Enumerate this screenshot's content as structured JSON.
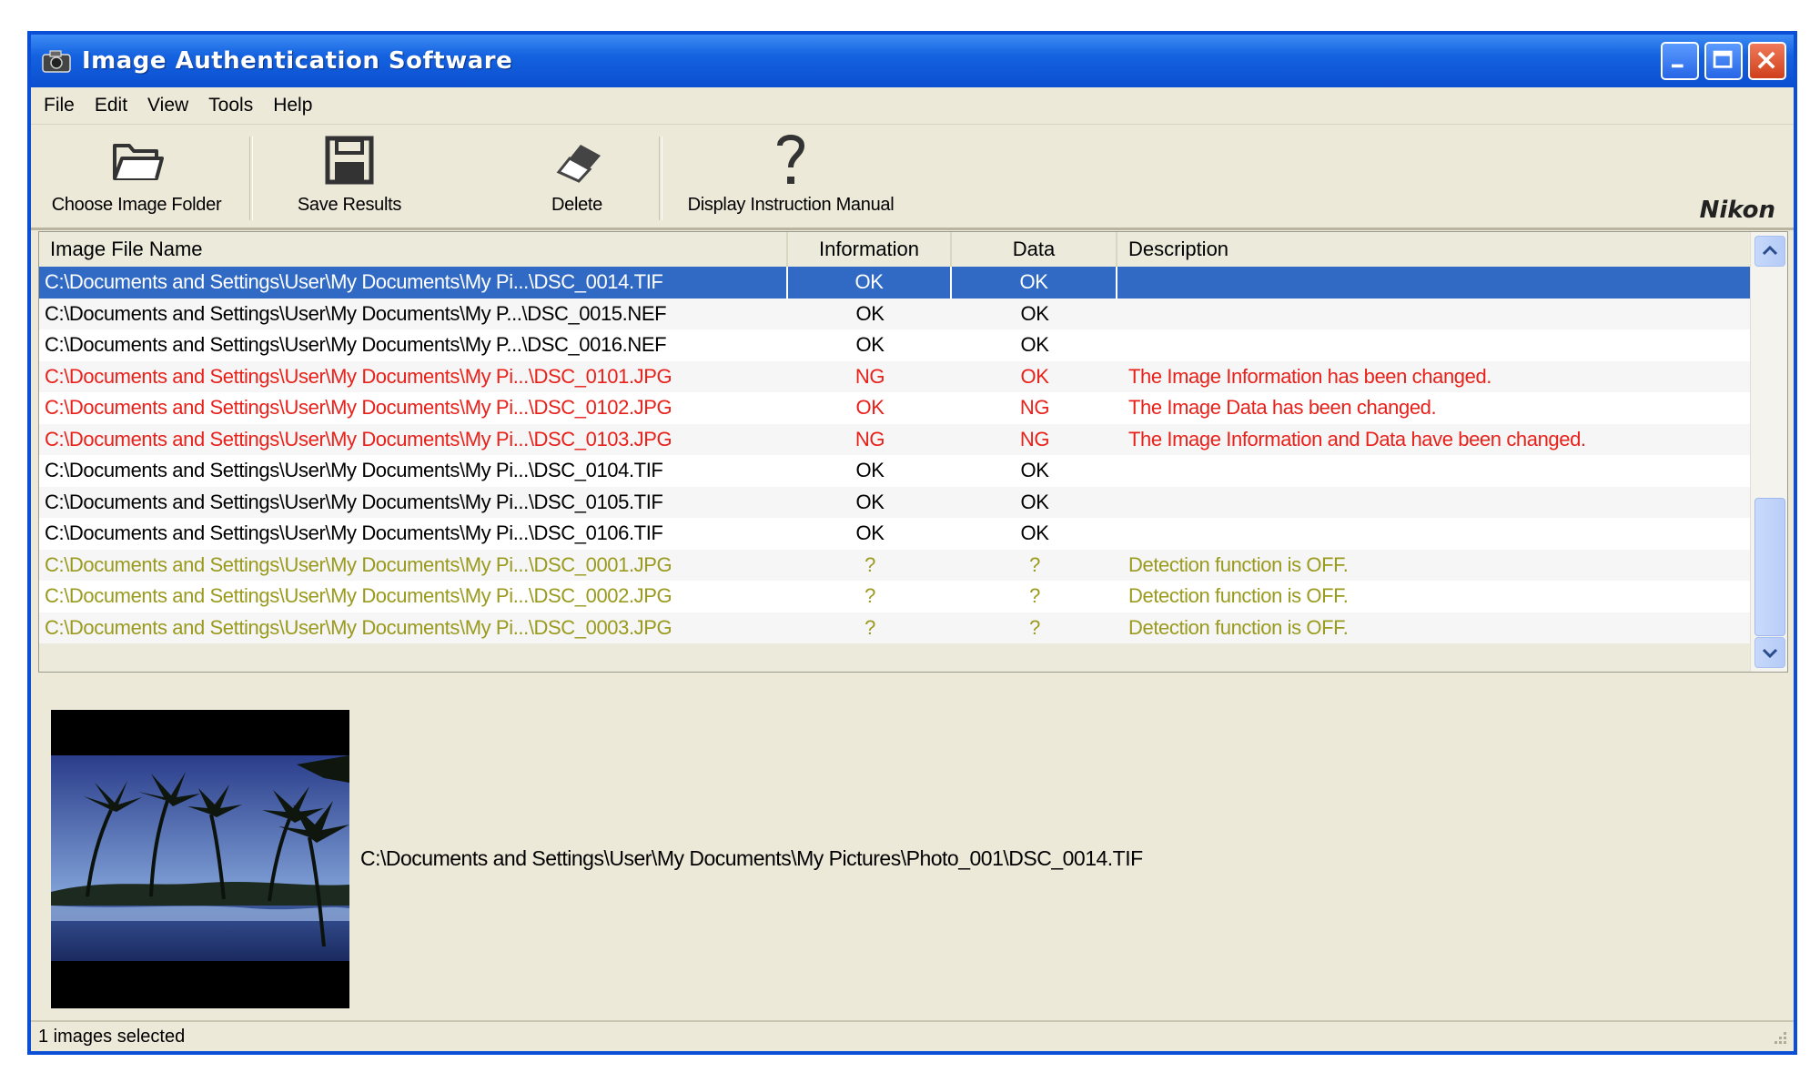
{
  "window": {
    "title": "Image Authentication Software",
    "icon": "camera-app-icon"
  },
  "menu": [
    "File",
    "Edit",
    "View",
    "Tools",
    "Help"
  ],
  "toolbar": {
    "choose_folder": "Choose Image Folder",
    "save_results": "Save Results",
    "delete": "Delete",
    "manual": "Display Instruction Manual",
    "brand": "Nikon"
  },
  "list": {
    "columns": [
      "Image File Name",
      "Information",
      "Data",
      "Description"
    ],
    "rows": [
      {
        "file": "C:\\Documents and Settings\\User\\My Documents\\My Pi...\\DSC_0014.TIF",
        "info": "OK",
        "data": "OK",
        "desc": "",
        "status": "selected"
      },
      {
        "file": "C:\\Documents and Settings\\User\\My Documents\\My P...\\DSC_0015.NEF",
        "info": "OK",
        "data": "OK",
        "desc": "",
        "status": "normal"
      },
      {
        "file": "C:\\Documents and Settings\\User\\My Documents\\My P...\\DSC_0016.NEF",
        "info": "OK",
        "data": "OK",
        "desc": "",
        "status": "normal"
      },
      {
        "file": "C:\\Documents and Settings\\User\\My Documents\\My Pi...\\DSC_0101.JPG",
        "info": "NG",
        "data": "OK",
        "desc": "The Image Information has been changed.",
        "status": "error"
      },
      {
        "file": "C:\\Documents and Settings\\User\\My Documents\\My Pi...\\DSC_0102.JPG",
        "info": "OK",
        "data": "NG",
        "desc": "The Image Data has been changed.",
        "status": "error"
      },
      {
        "file": "C:\\Documents and Settings\\User\\My Documents\\My Pi...\\DSC_0103.JPG",
        "info": "NG",
        "data": "NG",
        "desc": "The Image Information and Data have been changed.",
        "status": "error"
      },
      {
        "file": "C:\\Documents and Settings\\User\\My Documents\\My Pi...\\DSC_0104.TIF",
        "info": "OK",
        "data": "OK",
        "desc": "",
        "status": "normal"
      },
      {
        "file": "C:\\Documents and Settings\\User\\My Documents\\My Pi...\\DSC_0105.TIF",
        "info": "OK",
        "data": "OK",
        "desc": "",
        "status": "normal"
      },
      {
        "file": "C:\\Documents and Settings\\User\\My Documents\\My Pi...\\DSC_0106.TIF",
        "info": "OK",
        "data": "OK",
        "desc": "",
        "status": "normal"
      },
      {
        "file": "C:\\Documents and Settings\\User\\My Documents\\My Pi...\\DSC_0001.JPG",
        "info": "?",
        "data": "?",
        "desc": "Detection function is OFF.",
        "status": "off"
      },
      {
        "file": "C:\\Documents and Settings\\User\\My Documents\\My Pi...\\DSC_0002.JPG",
        "info": "?",
        "data": "?",
        "desc": "Detection function is OFF.",
        "status": "off"
      },
      {
        "file": "C:\\Documents and Settings\\User\\My Documents\\My Pi...\\DSC_0003.JPG",
        "info": "?",
        "data": "?",
        "desc": "Detection function is OFF.",
        "status": "off"
      }
    ]
  },
  "preview": {
    "path": "C:\\Documents and Settings\\User\\My Documents\\My Pictures\\Photo_001\\DSC_0014.TIF"
  },
  "status": "1 images selected",
  "colors": {
    "selected": "#316ac5",
    "error": "#e8211b",
    "off": "#9a9a1e",
    "titlebar": "#0b4fd0"
  }
}
